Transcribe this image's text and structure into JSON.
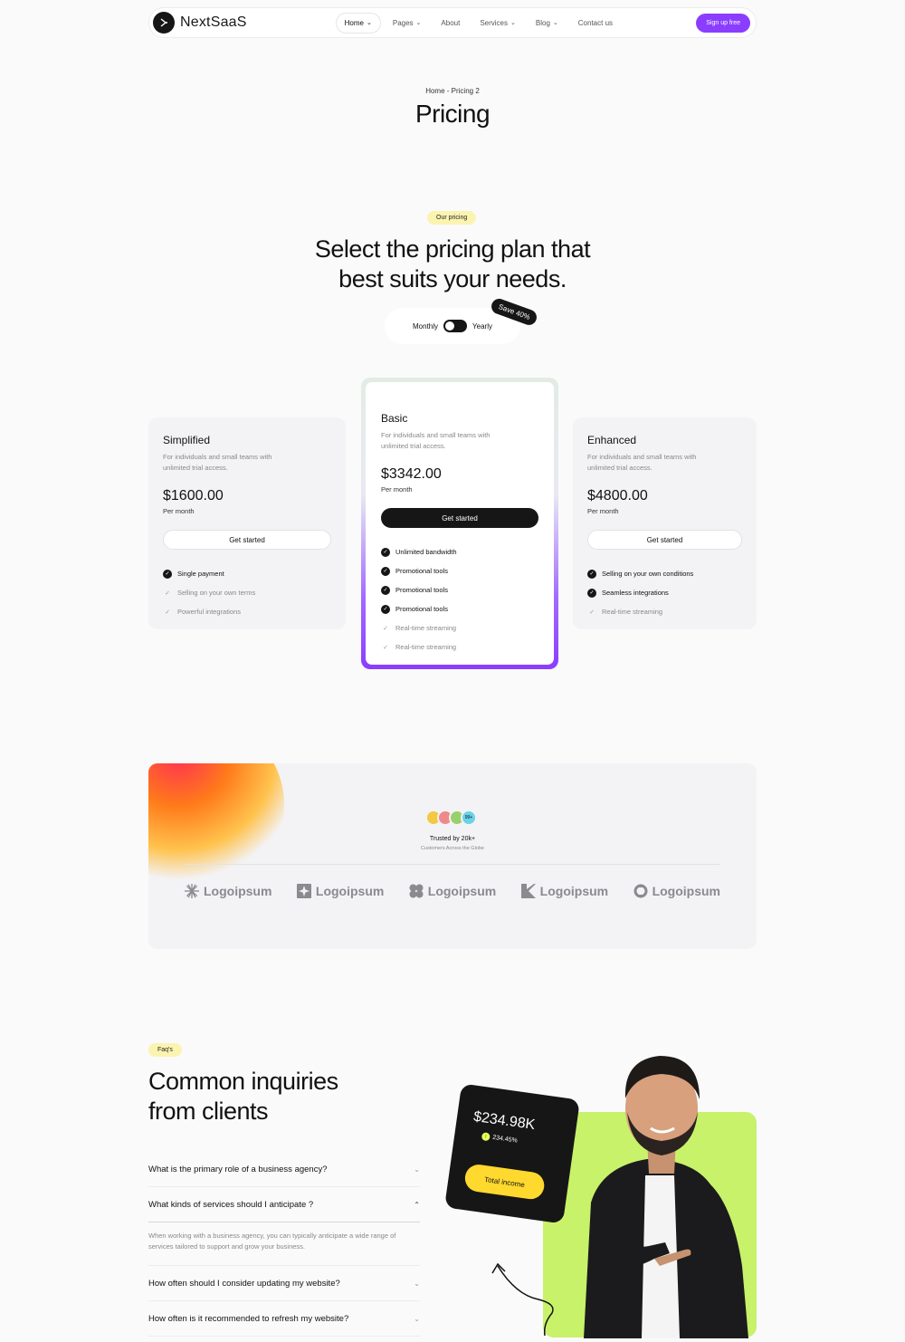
{
  "nav": {
    "brand": "NextSaaS",
    "items": [
      {
        "label": "Home",
        "has_chevron": true,
        "active": true
      },
      {
        "label": "Pages",
        "has_chevron": true,
        "active": false
      },
      {
        "label": "About",
        "has_chevron": false,
        "active": false
      },
      {
        "label": "Services",
        "has_chevron": true,
        "active": false
      },
      {
        "label": "Blog",
        "has_chevron": true,
        "active": false
      },
      {
        "label": "Contact us",
        "has_chevron": false,
        "active": false
      }
    ],
    "signup_label": "Sign up free",
    "accent_color": "#8b3dff"
  },
  "hero": {
    "breadcrumb": "Home - Pricing 2",
    "title": "Pricing"
  },
  "pricing": {
    "badge": "Our pricing",
    "heading_line1": "Select the pricing plan that",
    "heading_line2": "best suits your needs.",
    "toggle": {
      "monthly": "Monthly",
      "yearly": "Yearly",
      "save_tag": "Save 40%"
    },
    "plans": [
      {
        "name": "Simplified",
        "description": "For individuals and small teams with unlimited trial access.",
        "price": "$1600.00",
        "period": "Per month",
        "cta": "Get started",
        "features": [
          {
            "label": "Single payment",
            "included": true
          },
          {
            "label": "Selling on your own terms",
            "included": false
          },
          {
            "label": "Powerful integrations",
            "included": false
          }
        ]
      },
      {
        "name": "Basic",
        "description": "For individuals and small teams with unlimited trial access.",
        "price": "$3342.00",
        "period": "Per month",
        "cta": "Get started",
        "features": [
          {
            "label": "Unlimited bandwidth",
            "included": true
          },
          {
            "label": "Promotional tools",
            "included": true
          },
          {
            "label": "Promotional tools",
            "included": true
          },
          {
            "label": "Promotional tools",
            "included": true
          },
          {
            "label": "Real-time streaming",
            "included": false
          },
          {
            "label": "Real-time streaming",
            "included": false
          }
        ]
      },
      {
        "name": "Enhanced",
        "description": "For individuals and small teams with unlimited trial access.",
        "price": "$4800.00",
        "period": "Per month",
        "cta": "Get started",
        "features": [
          {
            "label": "Selling on your own conditions",
            "included": true
          },
          {
            "label": "Seamless integrations",
            "included": true
          },
          {
            "label": "Real-time streaming",
            "included": false
          }
        ]
      }
    ]
  },
  "trust": {
    "avatar_count_label": "99+",
    "title": "Trusted by 20k+",
    "subtitle": "Customers Across the Globe",
    "logos": [
      "Logoipsum",
      "Logoipsum",
      "Logoipsum",
      "Logoipsum",
      "Logoipsum"
    ]
  },
  "faq": {
    "badge": "Faq's",
    "heading_line1": "Common inquiries",
    "heading_line2": "from clients",
    "items": [
      {
        "question": "What is the primary role of a business agency?",
        "expanded": false
      },
      {
        "question": "What kinds of services should I anticipate ?",
        "expanded": true,
        "answer": "When working with a business agency, you can typically anticipate a wide range of services tailored to support and grow your business."
      },
      {
        "question": "How often should I consider updating my website?",
        "expanded": false
      },
      {
        "question": "How often is it recommended to refresh my website?",
        "expanded": false
      }
    ]
  },
  "income_card": {
    "value": "$234.98K",
    "change": "234.45%",
    "button": "Total income"
  }
}
